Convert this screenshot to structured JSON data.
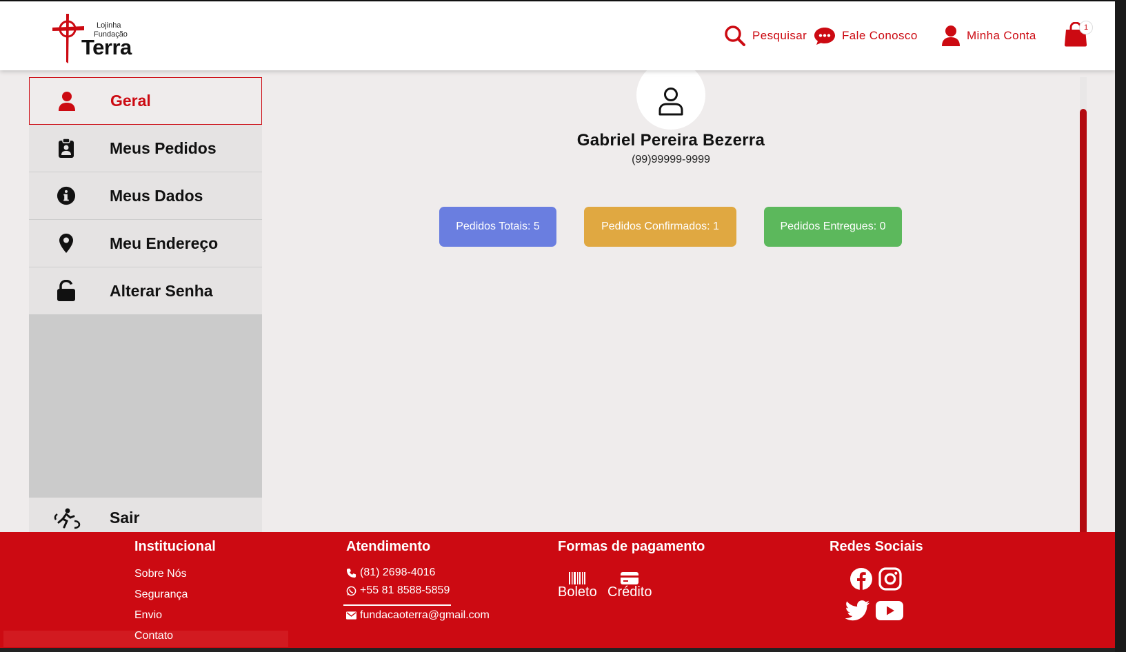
{
  "header": {
    "logo_small_1": "Lojinha",
    "logo_small_2": "Fundação",
    "logo_big": "Terra",
    "nav": {
      "search_label": "Pesquisar",
      "contact_label": "Fale Conosco",
      "account_label": "Minha Conta"
    },
    "cart_count": "1"
  },
  "sidebar": {
    "items": [
      {
        "label": "Geral",
        "icon": "user-icon"
      },
      {
        "label": "Meus Pedidos",
        "icon": "clipboard-user-icon"
      },
      {
        "label": "Meus Dados",
        "icon": "info-circle-icon"
      },
      {
        "label": "Meu Endereço",
        "icon": "location-pin-icon"
      },
      {
        "label": "Alterar Senha",
        "icon": "unlock-icon"
      }
    ],
    "logout_label": "Sair"
  },
  "profile": {
    "name": "Gabriel Pereira Bezerra",
    "phone": "(99)99999-9999",
    "stats": {
      "total": "Pedidos Totais: 5",
      "confirmed": "Pedidos Confirmados: 1",
      "delivered": "Pedidos Entregues: 0"
    }
  },
  "footer": {
    "institucional": {
      "title": "Institucional",
      "links": [
        "Sobre Nós",
        "Segurança",
        "Envio",
        "Contato"
      ]
    },
    "atendimento": {
      "title": "Atendimento",
      "phone": "(81) 2698-4016",
      "whatsapp": "+55 81 8588-5859",
      "email": "fundacaoterra@gmail.com"
    },
    "pagamento": {
      "title": "Formas de pagamento",
      "boleto": "Boleto",
      "credito": "Crédito"
    },
    "redes": {
      "title": "Redes Sociais"
    }
  },
  "colors": {
    "brand_red": "#cc0a12",
    "stat_total": "#6a7ee0",
    "stat_confirmed": "#e0a841",
    "stat_delivered": "#5cb85c"
  }
}
